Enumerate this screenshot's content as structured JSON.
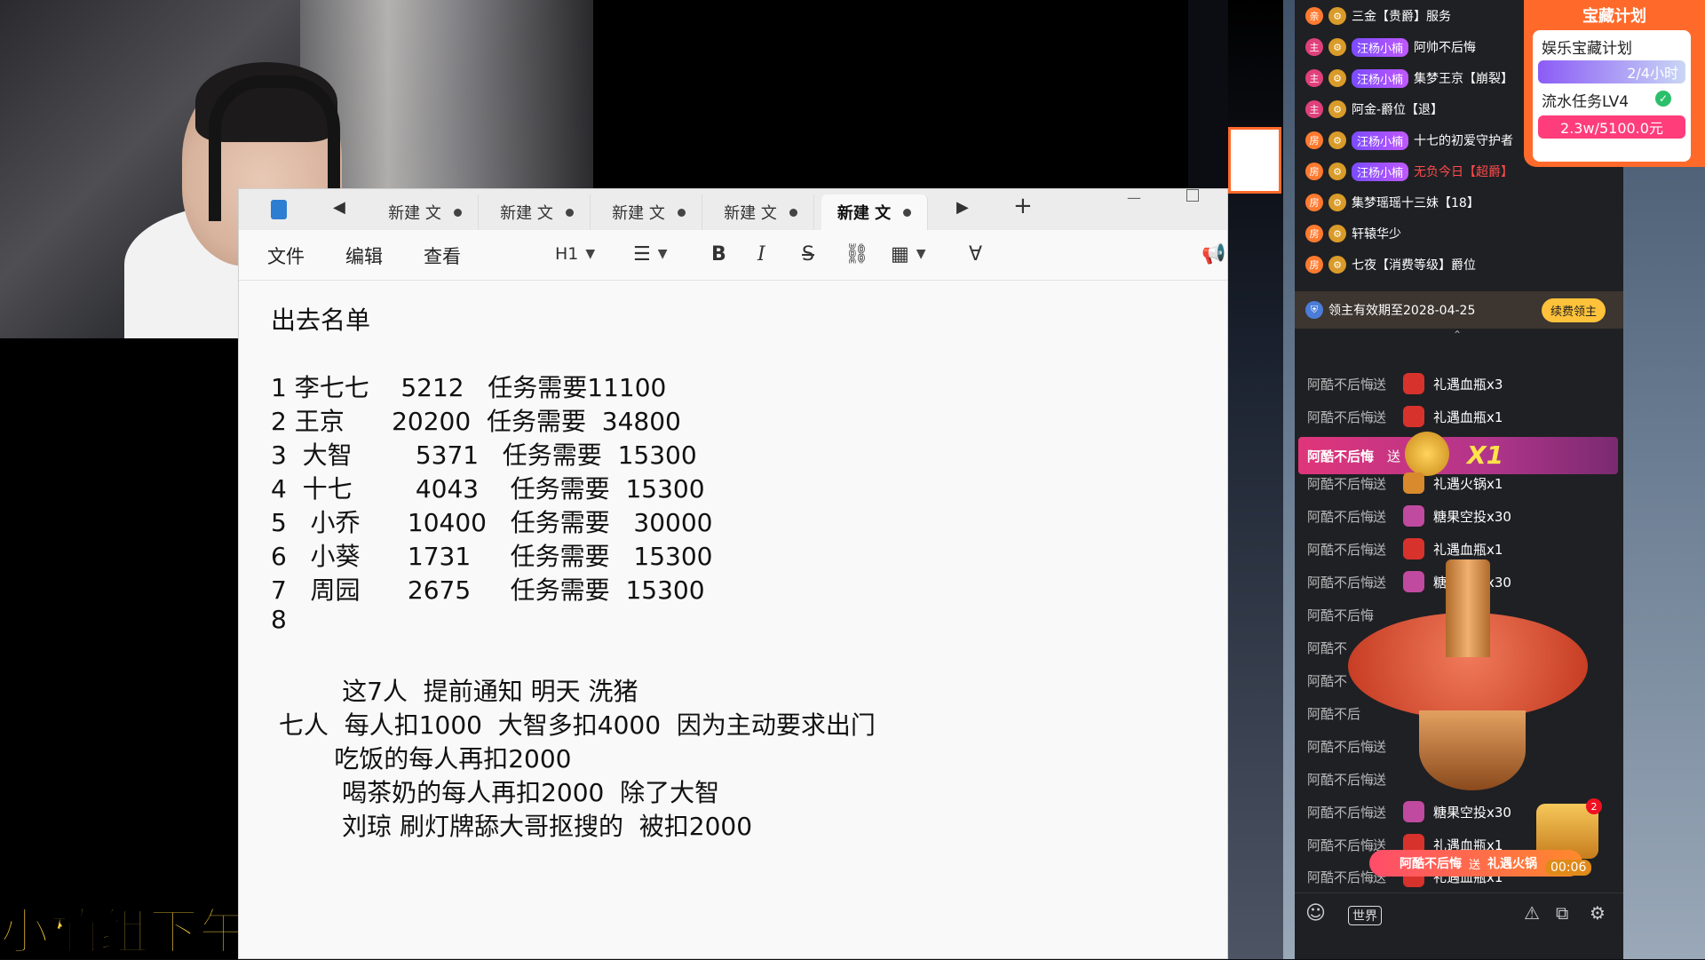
{
  "overlay": {
    "caption": "小楠组下午"
  },
  "notepad": {
    "tabs": [
      {
        "label": "新建 文"
      },
      {
        "label": "新建 文"
      },
      {
        "label": "新建 文"
      },
      {
        "label": "新建 文"
      },
      {
        "label": "新建 文",
        "active": true
      }
    ],
    "menus": [
      "文件",
      "编辑",
      "查看"
    ],
    "toolbar": {
      "heading": "H1",
      "bold": "B",
      "italic": "I",
      "strike": "S"
    },
    "lines": [
      "出去名单",
      "",
      "1 李七七    5212   任务需要11100",
      "2 王京      20200  任务需要  34800",
      "3  大智        5371   任务需要  15300",
      "4  十七        4043    任务需要  15300",
      "5   小乔      10400   任务需要   30000",
      "6   小葵      1731     任务需要   15300",
      "7   周园      2675     任务需要  15300",
      "8",
      "",
      "         这7人  提前通知 明天 洗猪",
      " 七人  每人扣1000  大智多扣4000  因为主动要求出门",
      "        吃饭的每人再扣2000",
      "         喝茶奶的每人再扣2000  除了大智",
      "         刘琼 刷灯牌舔大哥抠搜的  被扣2000"
    ]
  },
  "treasure": {
    "title": "宝藏计划",
    "item1_label": "娱乐宝藏计划",
    "item1_value": "2/4小时",
    "item2_label": "流水任务LV4",
    "item2_value": "2.3w/5100.0元"
  },
  "chat": {
    "messages": [
      {
        "text": "三金【贵爵】服务"
      },
      {
        "tag": "汪杨小楠",
        "text": "阿帅不后悔"
      },
      {
        "tag": "汪杨小楠",
        "text": "集梦王京【崩裂】"
      },
      {
        "text": "阿金-爵位【退】"
      },
      {
        "tag": "汪杨小楠",
        "text": "十七的初爱守护者"
      },
      {
        "tag": "汪杨小楠",
        "text": "无负今日【超爵】",
        "red": true
      },
      {
        "text": "集梦瑶瑶十三妹【18】"
      },
      {
        "text": "轩辕华少"
      },
      {
        "text": "七夜【消费等级】爵位"
      }
    ],
    "guardian_text": "领主有效期至2028-04-25",
    "renew_label": "续费领主",
    "gifts": [
      {
        "sender": "阿酷不后悔",
        "send": "送",
        "gift": "礼遇血瓶x3",
        "icon": "#d8322c"
      },
      {
        "sender": "阿酷不后悔",
        "send": "送",
        "gift": "礼遇血瓶x1",
        "icon": "#d8322c"
      },
      {
        "sender": "阿酷不后悔",
        "send": "送",
        "gift": "礼遇火锅x1",
        "icon": "#d88a2c"
      },
      {
        "sender": "阿酷不后悔",
        "send": "送",
        "gift": "糖果空投x30",
        "icon": "#c04aa0"
      },
      {
        "sender": "阿酷不后悔",
        "send": "送",
        "gift": "礼遇血瓶x1",
        "icon": "#d8322c"
      },
      {
        "sender": "阿酷不后悔",
        "send": "送",
        "gift": "糖果空投x30",
        "icon": "#c04aa0"
      },
      {
        "sender": "阿酷不后悔",
        "send": "送",
        "gift": "",
        "icon": "#444"
      },
      {
        "sender": "阿酷不",
        "send": "",
        "gift": "",
        "icon": "#444"
      },
      {
        "sender": "阿酷不",
        "send": "",
        "gift": "",
        "icon": "#444"
      },
      {
        "sender": "阿酷不后",
        "send": "",
        "gift": "",
        "icon": "#444"
      },
      {
        "sender": "阿酷不后悔",
        "send": "送",
        "gift": "",
        "icon": "#444"
      },
      {
        "sender": "阿酷不后悔",
        "send": "送",
        "gift": "",
        "icon": "#444"
      },
      {
        "sender": "阿酷不后悔",
        "send": "送",
        "gift": "糖果空投x30",
        "icon": "#c04aa0"
      },
      {
        "sender": "阿酷不后悔",
        "send": "送",
        "gift": "礼遇血瓶x1",
        "icon": "#d8322c"
      },
      {
        "sender": "阿酷不后悔",
        "send": "送",
        "gift": "礼遇血瓶x1",
        "icon": "#d8322c"
      }
    ],
    "highlight_sender": "阿酷不后悔",
    "highlight_send": "送",
    "highlight_combo": "X1",
    "popup_sender": "阿酷不后悔",
    "popup_gift": "礼遇火锅",
    "popup_timer": "00:06",
    "bottom_label": "世界"
  },
  "colors": {
    "accent_orange": "#ff6a2b",
    "treasure_bar1": "#8b5cf6",
    "treasure_bar2": "#ff3d7a",
    "highlight_pink": "#e0357a"
  }
}
